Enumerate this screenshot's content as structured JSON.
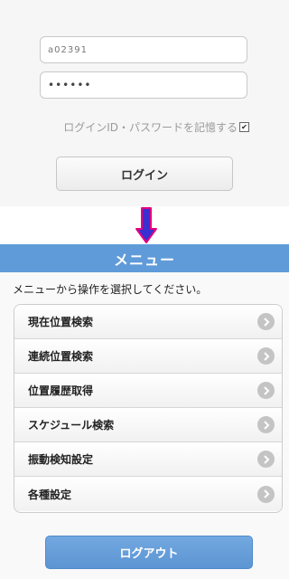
{
  "login": {
    "user_id_value": "a02391",
    "password_mask": "••••••",
    "remember_label": "ログインID・パスワードを記憶する",
    "remember_checked": true,
    "login_button": "ログイン"
  },
  "arrow": {
    "icon": "down-arrow-icon",
    "fill": "#3a2fd0",
    "stroke": "#e6007e"
  },
  "menu": {
    "header_title": "メニュー",
    "header_color": "#5f9bd9",
    "instruction": "メニューから操作を選択してください。",
    "items": [
      {
        "label": "現在位置検索"
      },
      {
        "label": "連続位置検索"
      },
      {
        "label": "位置履歴取得"
      },
      {
        "label": "スケジュール検索"
      },
      {
        "label": "振動検知設定"
      },
      {
        "label": "各種設定"
      }
    ],
    "logout_button": "ログアウト",
    "logout_color": "#5c95d3"
  }
}
